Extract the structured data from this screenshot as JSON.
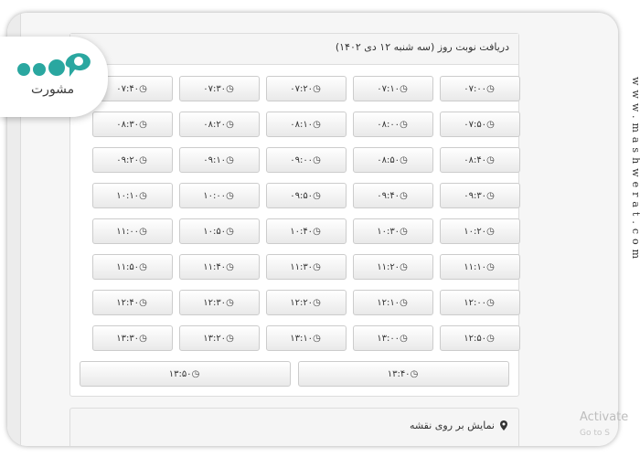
{
  "panel": {
    "title": "دریافت نوبت روز (سه شنبه ۱۲ دی ۱۴۰۲)"
  },
  "time_slots": [
    "۰۷:۰۰",
    "۰۷:۱۰",
    "۰۷:۲۰",
    "۰۷:۳۰",
    "۰۷:۴۰",
    "۰۷:۵۰",
    "۰۸:۰۰",
    "۰۸:۱۰",
    "۰۸:۲۰",
    "۰۸:۳۰",
    "۰۸:۴۰",
    "۰۸:۵۰",
    "۰۹:۰۰",
    "۰۹:۱۰",
    "۰۹:۲۰",
    "۰۹:۳۰",
    "۰۹:۴۰",
    "۰۹:۵۰",
    "۱۰:۰۰",
    "۱۰:۱۰",
    "۱۰:۲۰",
    "۱۰:۳۰",
    "۱۰:۴۰",
    "۱۰:۵۰",
    "۱۱:۰۰",
    "۱۱:۱۰",
    "۱۱:۲۰",
    "۱۱:۳۰",
    "۱۱:۴۰",
    "۱۱:۵۰",
    "۱۲:۰۰",
    "۱۲:۱۰",
    "۱۲:۲۰",
    "۱۲:۳۰",
    "۱۲:۴۰",
    "۱۲:۵۰",
    "۱۳:۰۰",
    "۱۳:۱۰",
    "۱۳:۲۰",
    "۱۳:۳۰",
    "۱۳:۴۰",
    "۱۳:۵۰"
  ],
  "map": {
    "label": "نمایش بر روی نقشه"
  },
  "logo": {
    "text": "مشورت"
  },
  "watermark": {
    "site": "www.mashwerat.com",
    "activate_title": "Activate",
    "activate_sub": "Go to S"
  },
  "colors": {
    "logo_accent": "#2aa7a0",
    "logo_dark": "#3a3a3a"
  },
  "icons": {
    "clock": "clock-icon",
    "map_pin": "map-marker-icon"
  }
}
